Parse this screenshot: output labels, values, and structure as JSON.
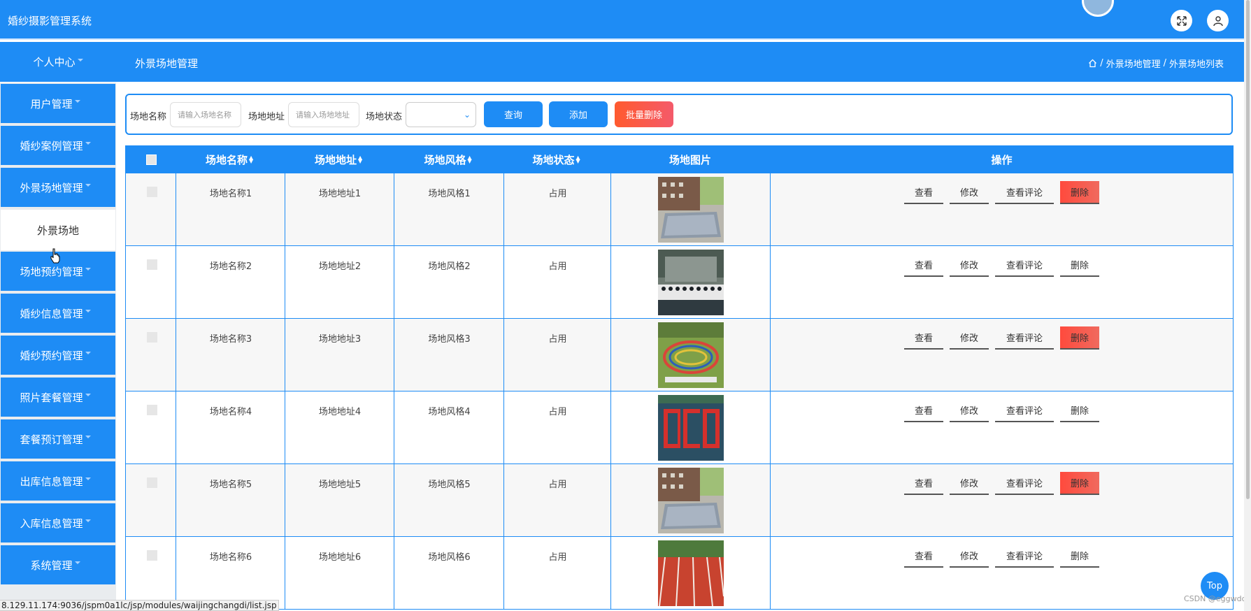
{
  "app": {
    "title": "婚纱摄影管理系统"
  },
  "subheader": {
    "personal_center": "个人中心",
    "page_title": "外景场地管理"
  },
  "breadcrumb": {
    "sep": "/",
    "item1": "外景场地管理",
    "item2": "外景场地列表"
  },
  "sidebar": {
    "items": [
      {
        "label": "用户管理"
      },
      {
        "label": "婚纱案例管理"
      },
      {
        "label": "外景场地管理"
      },
      {
        "label": "外景场地"
      },
      {
        "label": "场地预约管理"
      },
      {
        "label": "婚纱信息管理"
      },
      {
        "label": "婚纱预约管理"
      },
      {
        "label": "照片套餐管理"
      },
      {
        "label": "套餐预订管理"
      },
      {
        "label": "出库信息管理"
      },
      {
        "label": "入库信息管理"
      },
      {
        "label": "系统管理"
      }
    ]
  },
  "search": {
    "name_label": "场地名称",
    "name_placeholder": "请输入场地名称",
    "address_label": "场地地址",
    "address_placeholder": "请输入场地地址",
    "status_label": "场地状态",
    "status_value": "",
    "query_button": "查询",
    "add_button": "添加",
    "batch_delete_button": "批量删除"
  },
  "table": {
    "headers": [
      "场地名称",
      "场地地址",
      "场地风格",
      "场地状态",
      "场地图片",
      "操作"
    ],
    "rows": [
      {
        "name": "场地名称1",
        "address": "场地地址1",
        "style": "场地风格1",
        "status": "占用"
      },
      {
        "name": "场地名称2",
        "address": "场地地址2",
        "style": "场地风格2",
        "status": "占用"
      },
      {
        "name": "场地名称3",
        "address": "场地地址3",
        "style": "场地风格3",
        "status": "占用"
      },
      {
        "name": "场地名称4",
        "address": "场地地址4",
        "style": "场地风格4",
        "status": "占用"
      },
      {
        "name": "场地名称5",
        "address": "场地地址5",
        "style": "场地风格5",
        "status": "占用"
      },
      {
        "name": "场地名称6",
        "address": "场地地址6",
        "style": "场地风格6",
        "status": "占用"
      }
    ],
    "actions": {
      "view": "查看",
      "edit": "修改",
      "comments": "查看评论",
      "delete": "删除"
    }
  },
  "statusbar": {
    "url": "8.129.11.174:9036/jspm0a1lc/jsp/modules/waijingchangdi/list.jsp"
  },
  "top_button": "Top",
  "watermark": "CSDN @eggwdd",
  "colors": {
    "primary": "#1e8cf5",
    "danger": "#ff4a3d",
    "sidebar_active_bg": "#ffffff"
  },
  "icons": {
    "fullscreen": "expand-icon",
    "user": "user-icon",
    "home": "home-icon",
    "dropdown": "caret-down-icon"
  }
}
